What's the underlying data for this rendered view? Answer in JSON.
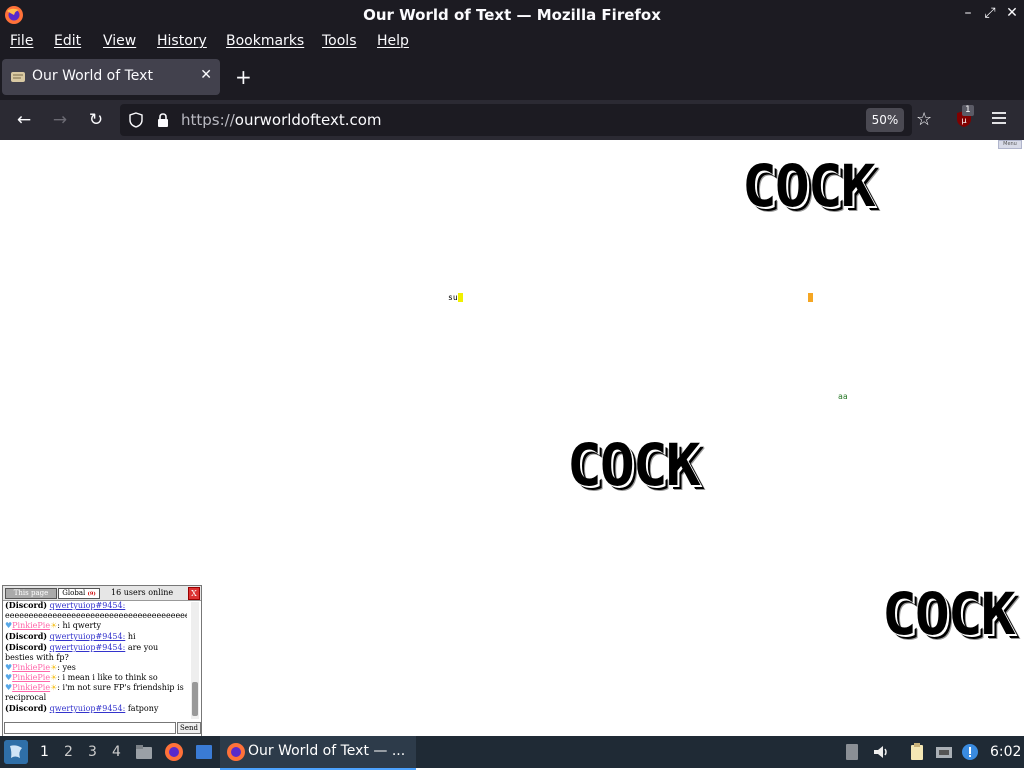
{
  "window": {
    "title": "Our World of Text — Mozilla Firefox"
  },
  "menubar": [
    "File",
    "Edit",
    "View",
    "History",
    "Bookmarks",
    "Tools",
    "Help"
  ],
  "tab": {
    "title": "Our World of Text"
  },
  "navbar": {
    "url_scheme": "https://",
    "url_host": "ourworldoftext.com",
    "zoom": "50%",
    "ublock_count": "1"
  },
  "canvas": {
    "words": [
      "COCK",
      "COCK",
      "COCK"
    ],
    "small_texts": [
      "su",
      "aa"
    ],
    "menu_hint": "Menu"
  },
  "chat": {
    "tab_page": "This page",
    "tab_global": "Global",
    "global_badge": "(9)",
    "online": "16 users online",
    "close": "X",
    "send": "Send",
    "messages": [
      {
        "source": "(Discord)",
        "user": "qwertyuiop#9454:",
        "text": " eeeeeeeeeeeeeeeeeeeeeeeeeeeeeeeeeeeeeeeeeeeeeeeeeeeeeeeeeeeeeeeeeeeeeeeeeee"
      },
      {
        "source": "",
        "user": "PinkiePie",
        "text": " hi qwerty"
      },
      {
        "source": "(Discord)",
        "user": "qwertyuiop#9454:",
        "text": " hi"
      },
      {
        "source": "(Discord)",
        "user": "qwertyuiop#9454:",
        "text": " are you besties with fp?"
      },
      {
        "source": "",
        "user": "PinkiePie",
        "text": " yes"
      },
      {
        "source": "",
        "user": "PinkiePie",
        "text": " i mean i like to think so"
      },
      {
        "source": "",
        "user": "PinkiePie",
        "text": " i'm not sure FP's friendship is reciprocal"
      },
      {
        "source": "(Discord)",
        "user": "qwertyuiop#9454:",
        "text": " fatpony"
      }
    ]
  },
  "taskbar": {
    "workspaces": [
      "1",
      "2",
      "3",
      "4"
    ],
    "task_label": "Our World of Text — ...",
    "clock": "6:02"
  },
  "colors": {
    "titlebar": "#1c1b22",
    "navbar": "#2b2a33",
    "taskbar": "#1f2a35",
    "yellow_cursor": "#f0f000",
    "orange_cursor": "#f5a623",
    "aa_green": "#2a7a2a"
  }
}
